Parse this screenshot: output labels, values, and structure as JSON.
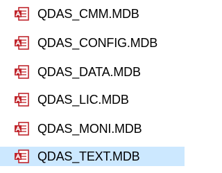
{
  "files": [
    {
      "name": "QDAS_CMM.MDB",
      "icon": "access-database-file-icon",
      "selected": false
    },
    {
      "name": "QDAS_CONFIG.MDB",
      "icon": "access-database-file-icon",
      "selected": false
    },
    {
      "name": "QDAS_DATA.MDB",
      "icon": "access-database-file-icon",
      "selected": false
    },
    {
      "name": "QDAS_LIC.MDB",
      "icon": "access-database-file-icon",
      "selected": false
    },
    {
      "name": "QDAS_MONI.MDB",
      "icon": "access-database-file-icon",
      "selected": false
    },
    {
      "name": "QDAS_TEXT.MDB",
      "icon": "access-database-file-icon",
      "selected": true
    }
  ],
  "colors": {
    "selection": "#cce8ff",
    "icon_red": "#c0262d",
    "text": "#000000"
  }
}
